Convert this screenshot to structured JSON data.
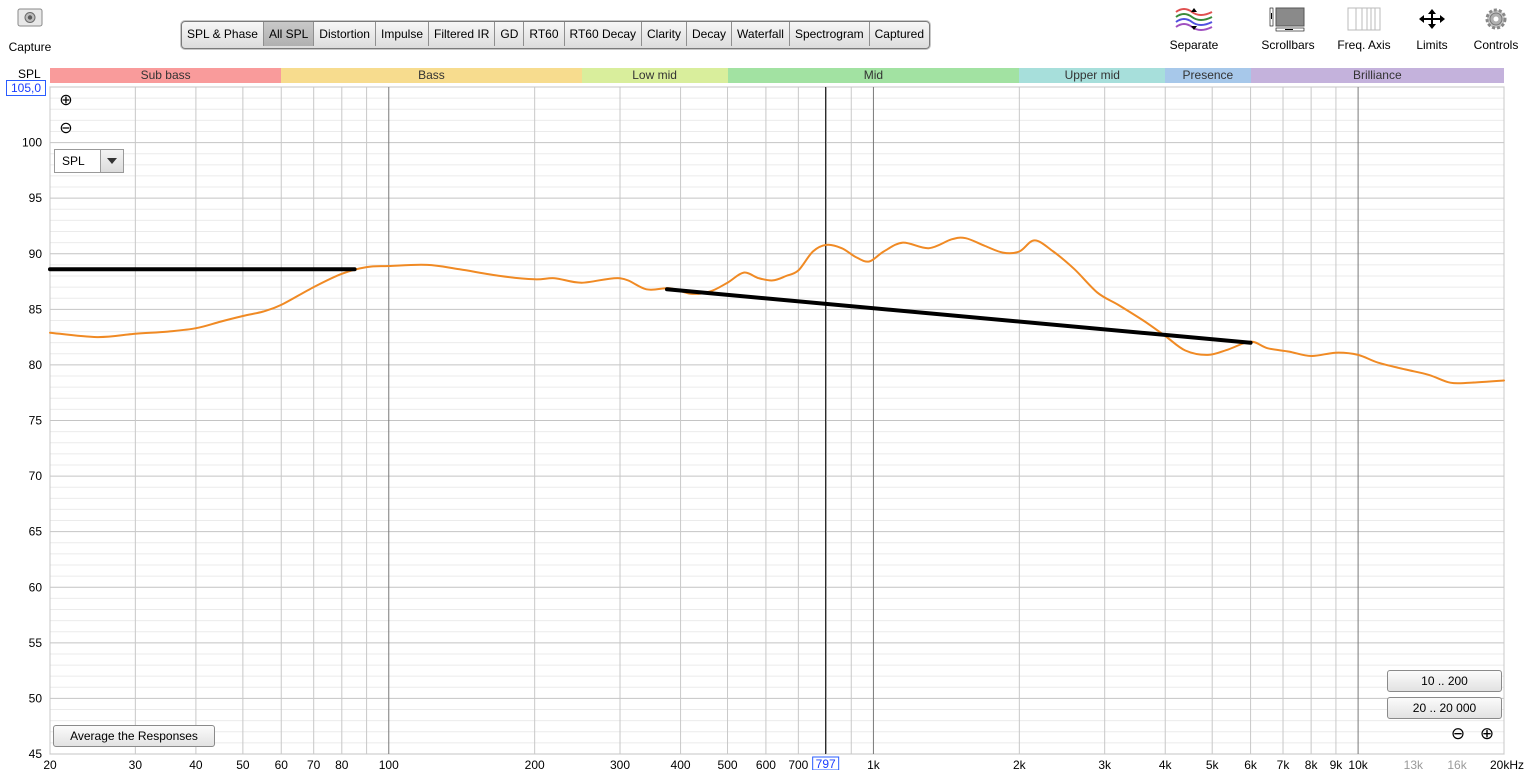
{
  "toolbar": {
    "capture_label": "Capture",
    "tabs": [
      "SPL & Phase",
      "All SPL",
      "Distortion",
      "Impulse",
      "Filtered IR",
      "GD",
      "RT60",
      "RT60 Decay",
      "Clarity",
      "Decay",
      "Waterfall",
      "Spectrogram",
      "Captured"
    ],
    "active_tab": "All SPL",
    "tools": [
      {
        "label": "Separate",
        "icon": "separate-icon"
      },
      {
        "label": "Scrollbars",
        "icon": "scrollbars-icon"
      },
      {
        "label": "Freq. Axis",
        "icon": "freq-axis-icon"
      },
      {
        "label": "Limits",
        "icon": "limits-icon"
      },
      {
        "label": "Controls",
        "icon": "gear-icon"
      }
    ]
  },
  "bands": [
    {
      "label": "Sub bass",
      "from": 20,
      "to": 60,
      "color": "#f99b9b"
    },
    {
      "label": "Bass",
      "from": 60,
      "to": 250,
      "color": "#f7dc8e"
    },
    {
      "label": "Low mid",
      "from": 250,
      "to": 500,
      "color": "#d9ee9c"
    },
    {
      "label": "Mid",
      "from": 500,
      "to": 2000,
      "color": "#a2e2a2"
    },
    {
      "label": "Upper mid",
      "from": 2000,
      "to": 4000,
      "color": "#a7dfdb"
    },
    {
      "label": "Presence",
      "from": 4000,
      "to": 6000,
      "color": "#a7c8ea"
    },
    {
      "label": "Brilliance",
      "from": 6000,
      "to": 20000,
      "color": "#c4b2dc"
    }
  ],
  "y_axis": {
    "title": "SPL",
    "top_value": "105,0",
    "ticks": [
      "100",
      "95",
      "90",
      "85",
      "80",
      "75",
      "70",
      "65",
      "60",
      "55",
      "50",
      "45"
    ]
  },
  "x_axis": {
    "ticks": [
      "20",
      "30",
      "40",
      "50",
      "60",
      "70",
      "80",
      "100",
      "200",
      "300",
      "400",
      "500",
      "600",
      "700",
      "1k",
      "2k",
      "3k",
      "4k",
      "5k",
      "6k",
      "7k",
      "8k",
      "9k",
      "10k",
      "13k",
      "16k",
      "20kHz"
    ],
    "cursor_value": "797"
  },
  "left_controls": {
    "zoom_in": "⊕",
    "zoom_out": "⊖",
    "select_value": "SPL"
  },
  "buttons": {
    "average": "Average the Responses",
    "range1": "10 .. 200",
    "range2": "20 .. 20 000",
    "zoom_out": "⊖",
    "zoom_in": "⊕"
  },
  "chart_data": {
    "type": "line",
    "x_scale": "log",
    "xlim": [
      20,
      20000
    ],
    "ylim": [
      45,
      105
    ],
    "cursor_x": 797,
    "series": [
      {
        "color": "#f08a24",
        "x": [
          20,
          25,
          30,
          35,
          40,
          45,
          50,
          55,
          60,
          70,
          80,
          90,
          100,
          120,
          140,
          170,
          200,
          220,
          250,
          300,
          340,
          380,
          420,
          460,
          500,
          540,
          580,
          620,
          660,
          700,
          750,
          800,
          860,
          920,
          980,
          1050,
          1150,
          1300,
          1450,
          1550,
          1700,
          1850,
          2000,
          2150,
          2350,
          2600,
          2900,
          3200,
          3600,
          4000,
          4400,
          4900,
          5400,
          6000,
          6500,
          7200,
          8000,
          9000,
          10000,
          11000,
          12500,
          14000,
          15500,
          17000,
          20000
        ],
        "y": [
          82.9,
          82.5,
          82.8,
          83.0,
          83.3,
          83.9,
          84.4,
          84.8,
          85.4,
          87.0,
          88.2,
          88.8,
          88.9,
          89.0,
          88.6,
          88.0,
          87.7,
          87.8,
          87.4,
          87.8,
          86.8,
          86.9,
          86.4,
          86.6,
          87.4,
          88.3,
          87.8,
          87.6,
          88.0,
          88.5,
          90.2,
          90.8,
          90.5,
          89.7,
          89.3,
          90.2,
          91.0,
          90.5,
          91.3,
          91.4,
          90.7,
          90.1,
          90.2,
          91.2,
          90.2,
          88.6,
          86.5,
          85.4,
          84.0,
          82.6,
          81.3,
          80.9,
          81.4,
          82.1,
          81.5,
          81.2,
          80.8,
          81.1,
          80.9,
          80.2,
          79.6,
          79.1,
          78.4,
          78.4,
          78.6
        ]
      },
      {
        "color": "#000000",
        "x": [
          20,
          85
        ],
        "y": [
          88.6,
          88.6
        ]
      },
      {
        "color": "#000000",
        "x": [
          375,
          6000
        ],
        "y": [
          86.8,
          82.0
        ]
      }
    ]
  }
}
